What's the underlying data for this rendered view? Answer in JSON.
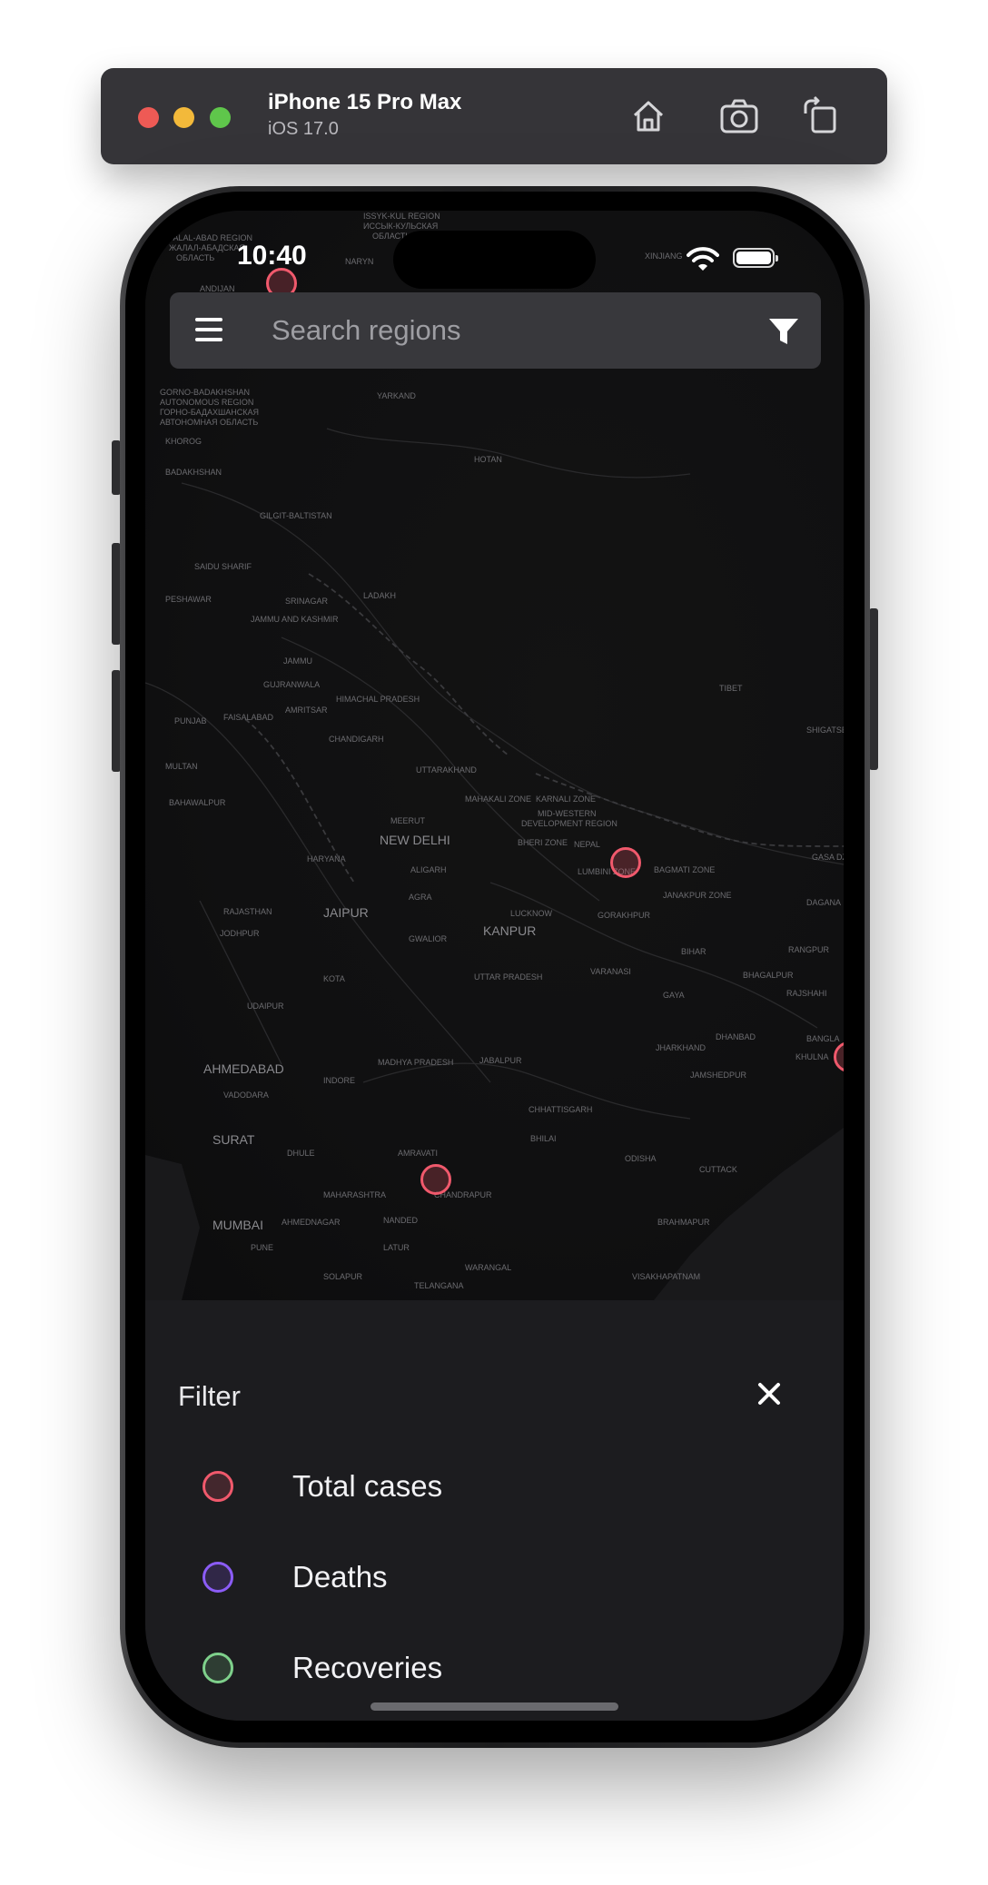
{
  "simulator": {
    "device_name": "iPhone 15 Pro Max",
    "os_version": "iOS 17.0",
    "icons": [
      "home-icon",
      "screenshot-icon",
      "rotate-icon"
    ]
  },
  "status_bar": {
    "time": "10:40",
    "icons": [
      "wifi-icon",
      "battery-icon"
    ]
  },
  "search": {
    "placeholder": "Search regions",
    "value": ""
  },
  "map": {
    "labels": [
      "ISSYK-KUL REGION",
      "ИССЫК-КУЛЬСКАЯ",
      "ОБЛАСТЬ",
      "JALAL-ABAD REGION",
      "ЖАЛАЛ-АБАДСКАЯ",
      "ОБЛАСТЬ",
      "NARYN",
      "XINJIANG",
      "ANDIJAN",
      "GORNO-BADAKHSHAN",
      "AUTONOMOUS REGION",
      "ГОРНО-БАДАХШАНСКАЯ",
      "АВТОНОМНАЯ ОБЛАСТЬ",
      "KHOROG",
      "BADAKHSHAN",
      "YARKAND",
      "HOTAN",
      "GILGIT-BALTISTAN",
      "SAIDU SHARIF",
      "PESHAWAR",
      "SRINAGAR",
      "LADAKH",
      "JAMMU AND KASHMIR",
      "JAMMU",
      "GUJRANWALA",
      "AMRITSAR",
      "HIMACHAL PRADESH",
      "PUNJAB",
      "FAISALABAD",
      "CHANDIGARH",
      "MULTAN",
      "BAHAWALPUR",
      "UTTARAKHAND",
      "MAHAKALI ZONE",
      "KARNALI ZONE",
      "MID-WESTERN",
      "DEVELOPMENT REGION",
      "NEW DELHI",
      "MEERUT",
      "BHERI ZONE",
      "NEPAL",
      "LUMBINI ZONE",
      "BAGMATI ZONE",
      "TIBET",
      "HARYANA",
      "ALIGARH",
      "AGRA",
      "RAJASTHAN",
      "JAIPUR",
      "JODHPUR",
      "LUCKNOW",
      "GORAKHPUR",
      "JANAKPUR ZONE",
      "KANPUR",
      "GWALIOR",
      "BIHAR",
      "KOTA",
      "UTTAR PRADESH",
      "VARANASI",
      "GAYA",
      "BHAGALPUR",
      "UDAIPUR",
      "DHANBAD",
      "AHMEDABAD",
      "MADHYA PRADESH",
      "JABALPUR",
      "JHARKHAND",
      "VADODARA",
      "INDORE",
      "JAMSHEDPUR",
      "SURAT",
      "CHHATTISGARH",
      "DHULE",
      "BHILAI",
      "ODISHA",
      "AMRAVATI",
      "CUTTACK",
      "MAHARASHTRA",
      "CHANDRAPUR",
      "BRAHMAPUR",
      "MUMBAI",
      "AHMEDNAGAR",
      "NANDED",
      "PUNE",
      "LATUR",
      "WARANGAL",
      "SOLAPUR",
      "TELANGANA",
      "VISAKHAPATNAM",
      "SHIGATSE",
      "GASA DZONG",
      "DAGANA",
      "RANGPUR",
      "RAJSHAHI",
      "KHULNA",
      "BANGLA"
    ],
    "markers": [
      {
        "metric": "Total cases",
        "location": "Naryn"
      },
      {
        "metric": "Total cases",
        "location": "Nepal"
      },
      {
        "metric": "Total cases",
        "location": "Bangladesh"
      },
      {
        "metric": "Total cases",
        "location": "Maharashtra"
      }
    ]
  },
  "filter_sheet": {
    "title": "Filter",
    "close_icon": "close-icon",
    "options": [
      {
        "label": "Total cases",
        "color": "#f0596c"
      },
      {
        "label": "Deaths",
        "color": "#8b5cf6"
      },
      {
        "label": "Recoveries",
        "color": "#7ed08b"
      }
    ]
  },
  "colors": {
    "map_background": "#101011",
    "sheet_background": "#1c1c1f",
    "search_background": "#38383c",
    "marker": "#f0596c"
  }
}
